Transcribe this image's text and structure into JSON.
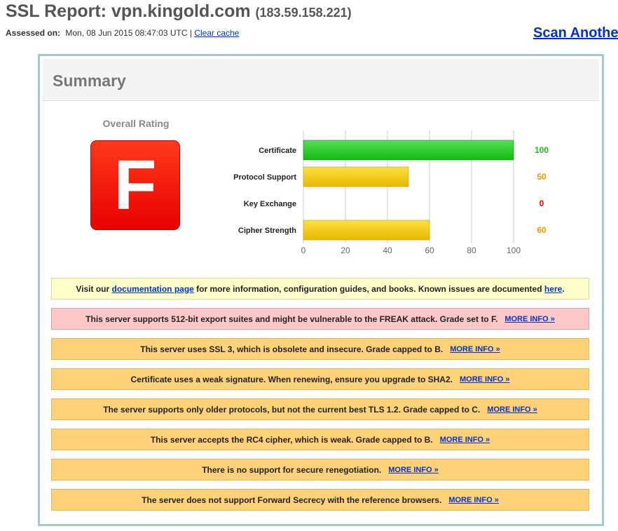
{
  "header": {
    "title_prefix": "SSL Report: ",
    "hostname": "vpn.kingold.com",
    "ip": "(183.59.158.221)",
    "assessed_label": "Assessed on:",
    "assessed_value": "Mon, 08 Jun 2015 08:47:03 UTC",
    "separator": "|",
    "clear_cache": "Clear cache",
    "scan_another": "Scan Anothe"
  },
  "summary": {
    "title": "Summary",
    "overall_label": "Overall Rating",
    "grade": "F",
    "grade_color": "#ff1a00"
  },
  "chart_data": {
    "type": "bar",
    "orientation": "horizontal",
    "categories": [
      "Certificate",
      "Protocol Support",
      "Key Exchange",
      "Cipher Strength"
    ],
    "values": [
      100,
      50,
      0,
      60
    ],
    "value_labels": [
      "100",
      "50",
      "0",
      "60"
    ],
    "value_colors": [
      "#22bb22",
      "#ee9900",
      "#ee0000",
      "#ee9900"
    ],
    "bar_colors": [
      "#22cc22",
      "#ffcc00",
      "#ffcc00",
      "#ffcc00"
    ],
    "xlim": [
      0,
      100
    ],
    "xticks": [
      "0",
      "20",
      "40",
      "60",
      "80",
      "100"
    ],
    "grid": true
  },
  "messages": [
    {
      "type": "info",
      "pre": "Visit our ",
      "link1": "documentation page",
      "mid": " for more information, configuration guides, and books. Known issues are documented ",
      "link2": "here",
      "post": "."
    },
    {
      "type": "error",
      "text": "This server supports 512-bit export suites and might be vulnerable to the FREAK attack. Grade set to F.",
      "more": "MORE INFO »"
    },
    {
      "type": "warn",
      "text": "This server uses SSL 3, which is obsolete and insecure. Grade capped to B.",
      "more": "MORE INFO »"
    },
    {
      "type": "warn",
      "text": "Certificate uses a weak signature. When renewing, ensure you upgrade to SHA2.",
      "more": "MORE INFO »"
    },
    {
      "type": "warn",
      "text": "The server supports only older protocols, but not the current best TLS 1.2. Grade capped to C.",
      "more": "MORE INFO »"
    },
    {
      "type": "warn",
      "text": "This server accepts the RC4 cipher, which is weak. Grade capped to B.",
      "more": "MORE INFO »"
    },
    {
      "type": "warn",
      "text": "There is no support for secure renegotiation.",
      "more": "MORE INFO »"
    },
    {
      "type": "warn",
      "text": "The server does not support Forward Secrecy with the reference browsers.",
      "more": "MORE INFO »"
    }
  ]
}
